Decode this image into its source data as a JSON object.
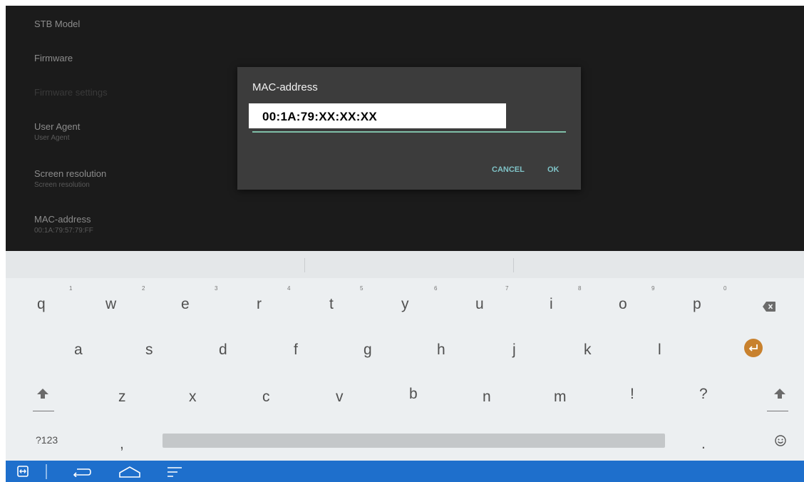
{
  "settings": {
    "items": [
      {
        "title": "STB Model",
        "subtitle": ""
      },
      {
        "title": "Firmware",
        "subtitle": ""
      },
      {
        "title": "Firmware settings",
        "subtitle": ""
      },
      {
        "title": "User Agent",
        "subtitle": "User Agent"
      },
      {
        "title": "Screen resolution",
        "subtitle": "Screen resolution"
      },
      {
        "title": "MAC-address",
        "subtitle": "00:1A:79:57:79:FF"
      }
    ]
  },
  "dialog": {
    "title": "MAC-address",
    "input_value": "00:1A:79:XX:XX:XX",
    "cancel_label": "CANCEL",
    "ok_label": "OK"
  },
  "keyboard": {
    "row1": [
      {
        "key": "q",
        "hint": "1"
      },
      {
        "key": "w",
        "hint": "2"
      },
      {
        "key": "e",
        "hint": "3"
      },
      {
        "key": "r",
        "hint": "4"
      },
      {
        "key": "t",
        "hint": "5"
      },
      {
        "key": "y",
        "hint": "6"
      },
      {
        "key": "u",
        "hint": "7"
      },
      {
        "key": "i",
        "hint": "8"
      },
      {
        "key": "o",
        "hint": "9"
      },
      {
        "key": "p",
        "hint": "0"
      }
    ],
    "row2": [
      "a",
      "s",
      "d",
      "f",
      "g",
      "h",
      "j",
      "k",
      "l"
    ],
    "row3": [
      "z",
      "x",
      "c",
      "v",
      "b",
      "n",
      "m",
      "!",
      "?"
    ],
    "symbols_label": "?123",
    "comma": ",",
    "period": ".",
    "accent_color": "#c8812e"
  },
  "navbar": {
    "color": "#1e6fcc",
    "icons": [
      "switch-keyboard-icon",
      "back-icon",
      "home-icon",
      "recents-icon"
    ]
  }
}
